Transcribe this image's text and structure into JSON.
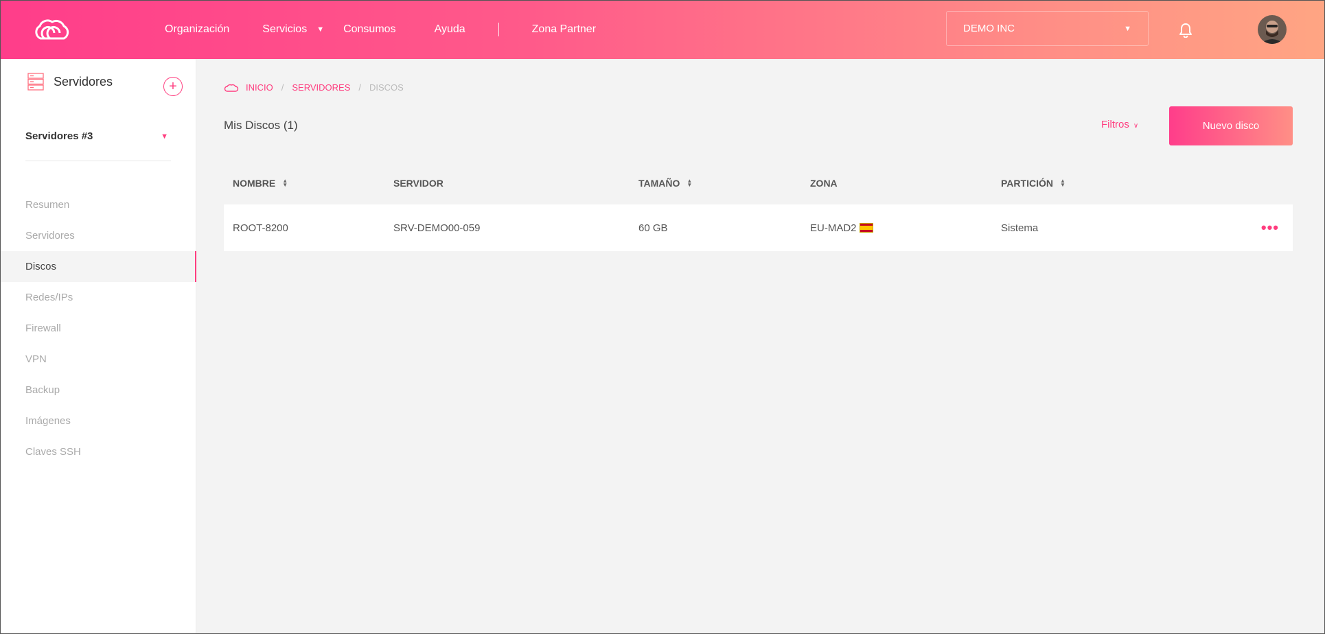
{
  "header": {
    "nav": [
      {
        "label": "Organización"
      },
      {
        "label": "Servicios"
      },
      {
        "label": "Consumos"
      },
      {
        "label": "Ayuda"
      },
      {
        "label": "Zona Partner"
      }
    ],
    "org_selected": "DEMO INC",
    "icons": {
      "logo": "cloud-logo-icon",
      "bell": "bell-icon",
      "avatar": "user-avatar"
    }
  },
  "sidebar": {
    "title": "Servidores",
    "add_label": "+",
    "group_label": "Servidores #3",
    "items": [
      {
        "label": "Resumen"
      },
      {
        "label": "Servidores"
      },
      {
        "label": "Discos"
      },
      {
        "label": "Redes/IPs"
      },
      {
        "label": "Firewall"
      },
      {
        "label": "VPN"
      },
      {
        "label": "Backup"
      },
      {
        "label": "Imágenes"
      },
      {
        "label": "Claves SSH"
      }
    ],
    "active_item": "Discos"
  },
  "breadcrumb": {
    "items": [
      "INICIO",
      "SERVIDORES",
      "DISCOS"
    ],
    "separator": "/"
  },
  "main": {
    "title": "Mis Discos (1)",
    "filters_label": "Filtros",
    "new_button_label": "Nuevo disco"
  },
  "table": {
    "columns": [
      "NOMBRE",
      "SERVIDOR",
      "TAMAÑO",
      "ZONA",
      "PARTICIÓN"
    ],
    "rows": [
      {
        "nombre": "ROOT-8200",
        "servidor": "SRV-DEMO00-059",
        "tamano": "60 GB",
        "zona": "EU-MAD2",
        "particion": "Sistema",
        "more": "•••"
      }
    ]
  },
  "colors": {
    "accent": "#ff3d7f",
    "gradient_start": "#ff3d8a",
    "gradient_end": "#ffa583"
  }
}
